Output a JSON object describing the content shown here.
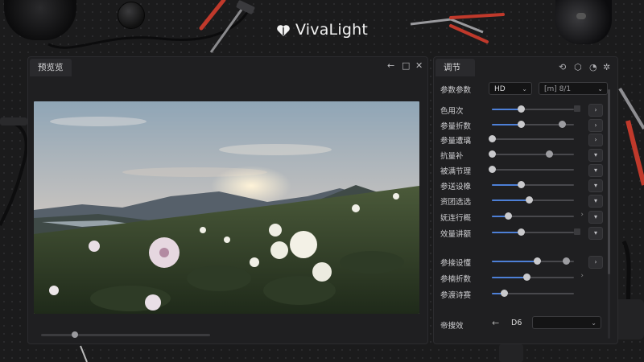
{
  "window": {
    "traffic_colors": [
      "#ff5f57",
      "#febc2e",
      "#28c840"
    ]
  },
  "brand": {
    "name": "VivaLight",
    "logo_icon": "heart-logo-icon"
  },
  "preview": {
    "tab_label": "预览览",
    "controls": {
      "back": "←",
      "maximize": "□",
      "close": "✕"
    },
    "scrub_progress": 0.2
  },
  "adjust": {
    "tab_label": "调节",
    "icons": [
      "history-icon",
      "cube-icon",
      "mask-icon",
      "gear-icon"
    ],
    "preset": {
      "label": "参数参数",
      "select_value": "HD",
      "select2_value": "[m] 8/1"
    },
    "sliders": [
      {
        "label": "色用次",
        "fill": 0.35,
        "mini": "›",
        "square": true
      },
      {
        "label": "参量折数",
        "fill": 0.35,
        "thumb2": 0.85,
        "mini": "›"
      },
      {
        "label": "参量遭璃",
        "fill": 0.0,
        "mini": "›"
      },
      {
        "label": "抗量补",
        "fill": 0.0,
        "thumb2": 0.7,
        "mini": "▾"
      },
      {
        "label": "被满节理",
        "fill": 0.0,
        "mini": "▾"
      },
      {
        "label": "参送设橡",
        "fill": 0.35,
        "mini": "▾"
      },
      {
        "label": "资团选选",
        "fill": 0.45,
        "mini": "▾"
      },
      {
        "label": "妩连行概",
        "fill": 0.2,
        "mini": "▾",
        "chev": true
      },
      {
        "label": "效量讲额",
        "fill": 0.35,
        "mini": "▾",
        "square": true
      },
      {
        "label": "参接设懂",
        "fill": 0.55,
        "thumb2": 0.9,
        "mini": "›"
      },
      {
        "label": "参楠折数",
        "fill": 0.42,
        "chev": true
      },
      {
        "label": "参渡诗赛",
        "fill": 0.15
      }
    ],
    "footer": {
      "label": "帝搜效",
      "arrow": "←",
      "value": "D6",
      "select_value": ""
    }
  }
}
